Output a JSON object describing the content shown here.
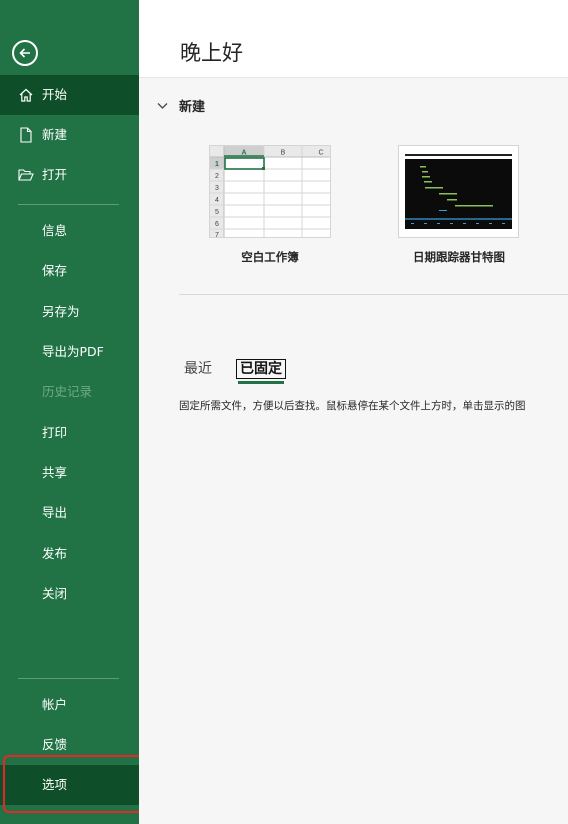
{
  "sidebar": {
    "items": [
      {
        "label": "开始",
        "icon": "home-icon"
      },
      {
        "label": "新建",
        "icon": "new-file-icon"
      },
      {
        "label": "打开",
        "icon": "open-folder-icon"
      },
      {
        "label": "信息"
      },
      {
        "label": "保存"
      },
      {
        "label": "另存为"
      },
      {
        "label": "导出为PDF"
      },
      {
        "label": "历史记录"
      },
      {
        "label": "打印"
      },
      {
        "label": "共享"
      },
      {
        "label": "导出"
      },
      {
        "label": "发布"
      },
      {
        "label": "关闭"
      },
      {
        "label": "帐户"
      },
      {
        "label": "反馈"
      },
      {
        "label": "选项"
      }
    ],
    "colors": {
      "background": "#217346",
      "active": "#0e4f2a",
      "highlight_border": "#e8262a"
    }
  },
  "main": {
    "greeting": "晚上好",
    "new_section": {
      "title": "新建",
      "templates": [
        {
          "name": "空白工作簿",
          "sheet_cols": [
            "A",
            "B",
            "C"
          ],
          "sheet_rows": [
            "1",
            "2",
            "3",
            "4",
            "5",
            "6",
            "7"
          ]
        },
        {
          "name": "日期跟踪器甘特图"
        }
      ]
    },
    "tabs": [
      "最近",
      "已固定"
    ],
    "pinned_description": "固定所需文件，方便以后查找。鼠标悬停在某个文件上方时，单击显示的图"
  }
}
